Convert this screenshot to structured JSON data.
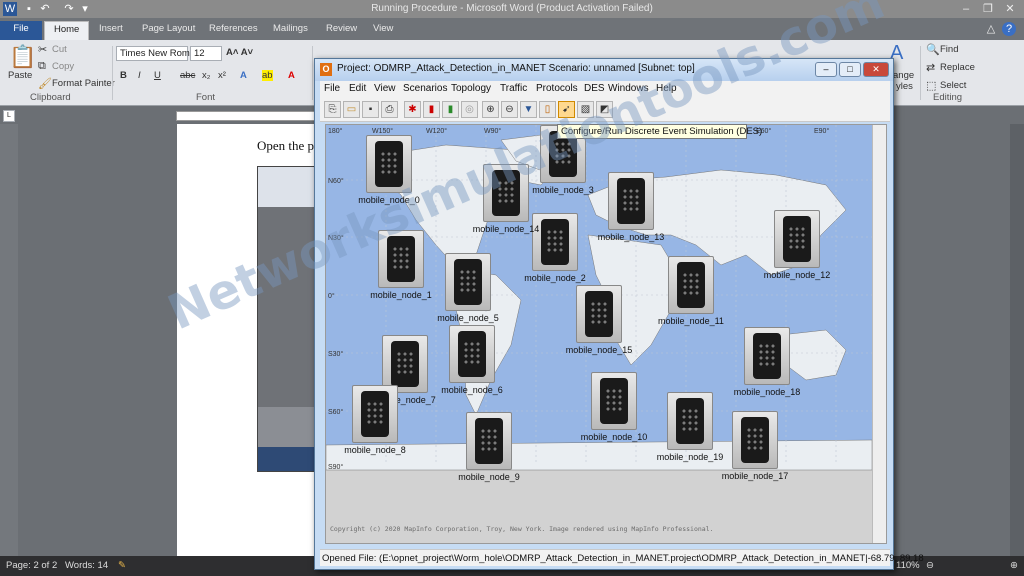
{
  "word": {
    "title": "Running Procedure  -  Microsoft Word (Product Activation Failed)",
    "tabs": [
      "File",
      "Home",
      "Insert",
      "Page Layout",
      "References",
      "Mailings",
      "Review",
      "View"
    ],
    "clipboard": {
      "paste": "Paste",
      "cut": "Cut",
      "copy": "Copy",
      "format_painter": "Format Painter",
      "label": "Clipboard"
    },
    "font": {
      "name": "Times New Rom",
      "size": "12",
      "label": "Font"
    },
    "editing": {
      "find": "Find",
      "replace": "Replace",
      "select": "Select",
      "label": "Editing",
      "change_styles": "ange\nyles"
    },
    "doc_text": "Open the p",
    "status": {
      "page": "Page: 2 of 2",
      "words": "Words: 14",
      "zoom": "110%"
    }
  },
  "opnet": {
    "title": "Project: ODMRP_Attack_Detection_in_MANET Scenario: unnamed  [Subnet: top]",
    "menu": [
      "File",
      "Edit",
      "View",
      "Scenarios",
      "Topology",
      "Traffic",
      "Protocols",
      "DES",
      "Windows",
      "Help"
    ],
    "tooltip": "Configure/Run Discrete Event Simulation (DES)",
    "lon_labels": [
      "180°",
      "W150°",
      "W120°",
      "W90°",
      "E60°",
      "E90°"
    ],
    "lat_labels": [
      "N60°",
      "N30°",
      "0°",
      "S30°",
      "S60°",
      "S90°"
    ],
    "copyright": "Copyright (c) 2020 MapInfo Corporation, Troy, New York. Image rendered using MapInfo Professional.",
    "status": "Opened File: (E:\\opnet_project\\Worm_hole\\ODMRP_Attack_Detection_in_MANET.project\\ODMRP_Attack_Detection_in_MANET|-68.79, 89.18",
    "nodes": [
      {
        "label": "mobile_node_0"
      },
      {
        "label": "mobile_node_1"
      },
      {
        "label": "mobile_node_2"
      },
      {
        "label": "mobile_node_3"
      },
      {
        "label": "mobile_node_5"
      },
      {
        "label": "mobile_node_6"
      },
      {
        "label": "mobile_node_7"
      },
      {
        "label": "mobile_node_8"
      },
      {
        "label": "mobile_node_9"
      },
      {
        "label": "mobile_node_10"
      },
      {
        "label": "mobile_node_11"
      },
      {
        "label": "mobile_node_12"
      },
      {
        "label": "mobile_node_13"
      },
      {
        "label": "mobile_node_14"
      },
      {
        "label": "mobile_node_15"
      },
      {
        "label": "mobile_node_17"
      },
      {
        "label": "mobile_node_18"
      },
      {
        "label": "mobile_node_19"
      }
    ]
  },
  "watermark": "Networksimulationtools.com"
}
